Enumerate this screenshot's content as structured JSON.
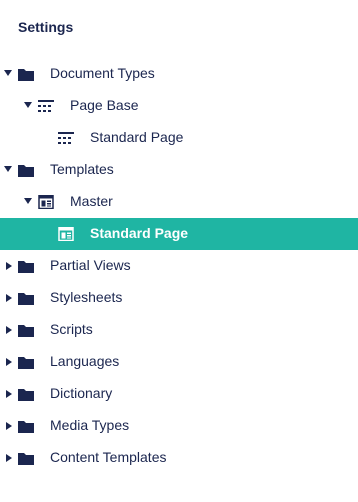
{
  "header": {
    "title": "Settings"
  },
  "tree": {
    "document_types": "Document Types",
    "page_base": "Page Base",
    "standard_page_doc": "Standard Page",
    "templates": "Templates",
    "master": "Master",
    "standard_page_tpl": "Standard Page",
    "partial_views": "Partial Views",
    "stylesheets": "Stylesheets",
    "scripts": "Scripts",
    "languages": "Languages",
    "dictionary": "Dictionary",
    "media_types": "Media Types",
    "content_templates": "Content Templates"
  },
  "colors": {
    "active_bg": "#1fb5a3",
    "text": "#1b264f"
  },
  "icons": {
    "folder": "folder-icon",
    "doctype": "doctype-grid-icon",
    "template": "template-icon"
  }
}
